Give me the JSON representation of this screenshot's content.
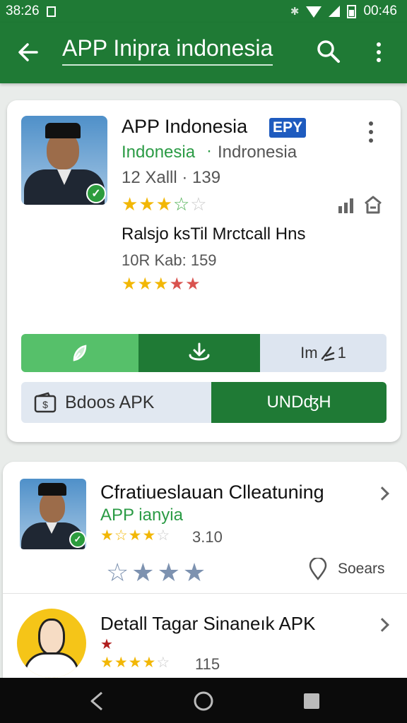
{
  "status_bar": {
    "time_left": "38:26",
    "time_right": "00:46"
  },
  "app_bar": {
    "title": "APP Inipra indonesia"
  },
  "main_card": {
    "app_name": "APP Indonesia",
    "badge": "EPY",
    "developer": "Indonesia",
    "separator": "·",
    "region": "Indronesia",
    "meta_line": "12 Xalll  · 139",
    "rating_stars": "★★★☆☆",
    "section_title": "Ralsjo ksTil Mrctcall Hns",
    "section_meta": "10R Kab: 159",
    "section_stars": "★★★★★",
    "segment_count": "Im",
    "segment_number": "1",
    "apk_button_label": "Bdoos APK",
    "primary_button_label": "UNDʤH"
  },
  "list": [
    {
      "title": "Cfratiueslauan Clleatuning",
      "subtitle": "APP ianyia",
      "stars": "★★★★☆",
      "rating_count": "3.10",
      "big_stars": "☆★★★",
      "location_label": "Soears"
    },
    {
      "title": "Detall Tagar Sinaneık APK",
      "small_star": "★",
      "stars": "★★★★☆",
      "rating_count": "115"
    }
  ],
  "colors": {
    "brand_green": "#1f7a35",
    "light_green": "#56c06a",
    "star_gold": "#f2b705"
  },
  "icons": [
    "back-arrow-icon",
    "search-icon",
    "more-vert-icon",
    "verified-check-icon",
    "signal-bars-icon",
    "store-icon",
    "leaf-icon",
    "download-icon",
    "hand-icon",
    "wallet-icon",
    "location-pin-icon",
    "chevron-right-icon",
    "nav-back-icon",
    "nav-home-icon",
    "nav-recents-icon"
  ]
}
